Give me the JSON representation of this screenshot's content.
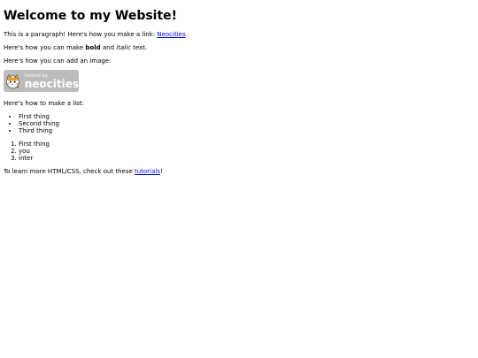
{
  "heading": "Welcome to my Website!",
  "paragraph1": {
    "before": "This is a paragraph! Here's how you make a link: ",
    "link": "Neocities",
    "after": "."
  },
  "paragraph2": {
    "before": "Here's how you can make ",
    "bold": "bold",
    "middle": " and ",
    "italic": "italic",
    "after": " text."
  },
  "paragraph3": "Here's how you can add an image:",
  "badge": {
    "hosted_by": "hosted by",
    "brand": "neocities",
    "colors": {
      "background": "#bcbcbc",
      "text": "#ffffff",
      "cat_orange": "#f5a623"
    }
  },
  "paragraph4": "Here's how to make a list:",
  "unordered_list": [
    "First thing",
    "Second thing",
    "Third thing"
  ],
  "ordered_list": [
    "First thing",
    "you",
    "inter"
  ],
  "paragraph5": {
    "before": "To learn more HTML/CSS, check out these ",
    "link": "tutorials",
    "after": "!"
  },
  "colors": {
    "link": "#0000ee",
    "text": "#000000",
    "background": "#ffffff"
  }
}
